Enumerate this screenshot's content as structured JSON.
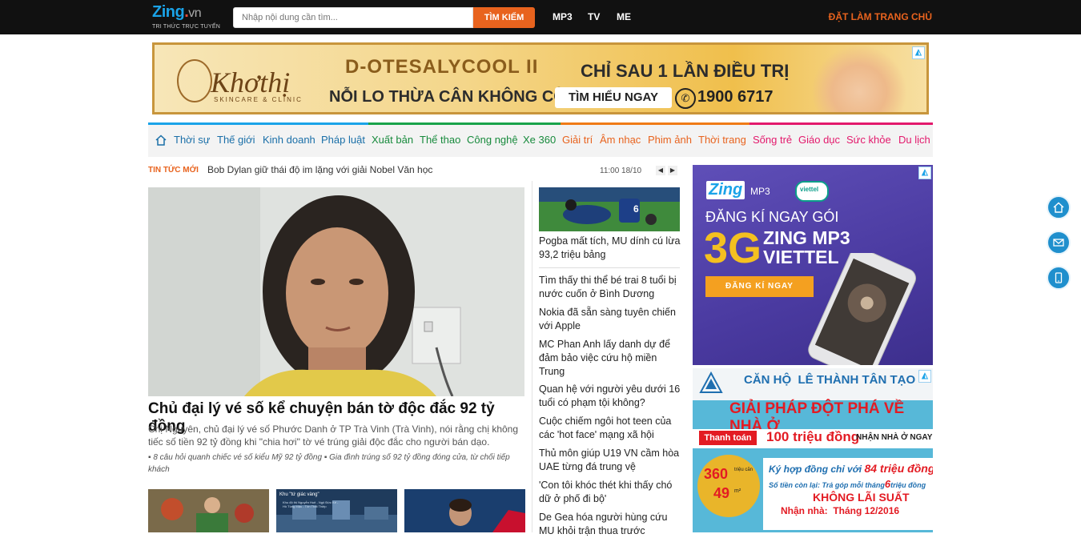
{
  "topbar": {
    "logo_text": "Zing",
    "logo_dot": ".",
    "logo_tld": "vn",
    "logo_tagline": "TRI THỨC TRỰC TUYẾN",
    "search_placeholder": "Nhập nội dung cần tìm...",
    "search_button": "TÌM KIẾM",
    "links": [
      "MP3",
      "TV",
      "ME"
    ],
    "set_homepage": "ĐẶT LÀM TRANG CHỦ",
    "accent": "#e8631e"
  },
  "top_banner": {
    "brand": "Khơthị",
    "brand_sub": "SKINCARE & CLINIC",
    "product": "D-OTESALYCOOL II",
    "slogan": "NỖI LO THỪA CÂN KHÔNG CÒN",
    "headline": "CHỈ SAU 1 LẦN ĐIỀU TRỊ",
    "cta": "TÌM HIỂU NGAY",
    "phone": "1900 6717"
  },
  "categories": {
    "home_icon": "home-icon",
    "group_colors": [
      "#1aa3e8",
      "#19a34a",
      "#f07b16",
      "#e3196c"
    ],
    "items": [
      {
        "label": "Thời sự",
        "color": "#1a6fa8"
      },
      {
        "label": "Thế giới",
        "color": "#1a6fa8"
      },
      {
        "label": "Kinh doanh",
        "color": "#1a6fa8"
      },
      {
        "label": "Pháp luật",
        "color": "#1a6fa8"
      },
      {
        "label": "Xuất bản",
        "color": "#178a3c"
      },
      {
        "label": "Thể thao",
        "color": "#178a3c"
      },
      {
        "label": "Công nghệ",
        "color": "#178a3c"
      },
      {
        "label": "Xe 360",
        "color": "#178a3c"
      },
      {
        "label": "Giải trí",
        "color": "#e8631e"
      },
      {
        "label": "Âm nhạc",
        "color": "#e8631e"
      },
      {
        "label": "Phim ảnh",
        "color": "#e8631e"
      },
      {
        "label": "Thời trang",
        "color": "#e8631e"
      },
      {
        "label": "Sống trẻ",
        "color": "#e3196c"
      },
      {
        "label": "Giáo dục",
        "color": "#e3196c"
      },
      {
        "label": "Sức khỏe",
        "color": "#e3196c"
      },
      {
        "label": "Du lịch",
        "color": "#e3196c"
      }
    ]
  },
  "ticker": {
    "label": "TIN TỨC MỚI",
    "headline": "Bob Dylan giữ thái độ im lặng với giải Nobel Văn học",
    "time": "11:00 18/10"
  },
  "hero": {
    "title": "Chủ đại lý vé số kể chuyện bán tờ độc đắc 92 tỷ đồng",
    "sapo": "Chị Nguyên, chủ đại lý vé số Phước Danh ở TP Trà Vinh (Trà Vinh), nói rằng chị không tiếc số tiền 92 tỷ đồng khi \"chia hơi\" tờ vé trúng giải độc đắc cho người bán dạo.",
    "related": [
      "8 câu hỏi quanh chiếc vé số kiểu Mỹ 92 tỷ đồng",
      "Gia đình trúng số 92 tỷ đồng đóng cửa, từ chối tiếp khách"
    ]
  },
  "thumbs": {
    "middle_caption_1": "Khu \"tứ giác vàng\"",
    "middle_caption_2": "Khu đô thị Nguyễn Huệ - Ngô Đức Kế - Hồ Tùng Mậu - Tôn Thất Thiệp"
  },
  "side_news": {
    "jersey_number": "6",
    "items": [
      "Pogba mất tích, MU dính cú lừa 93,2 triệu bảng",
      "Tìm thấy thi thể bé trai 8 tuổi bị nước cuốn ở Bình Dương",
      "Nokia đã sẵn sàng tuyên chiến với Apple",
      "MC Phan Anh lấy danh dự để đảm bảo việc cứu hộ miền Trung",
      "Quan hệ với người yêu dưới 16 tuổi có phạm tội không?",
      "Cuộc chiếm ngôi hot teen của các 'hot face' mạng xã hội",
      "Thủ môn giúp U19 VN cầm hòa UAE từng đá trung vệ",
      "'Con tôi khóc thét khi thấy chó dữ ở phố đi bộ'",
      "De Gea hóa người hùng cứu MU khỏi trận thua trước"
    ]
  },
  "ad_mp3": {
    "brand": "Zing",
    "brand_sub": "MP3",
    "partner": "viettel",
    "line1": "ĐĂNG KÍ NGAY GÓI",
    "big": "3G",
    "line2a": "ZING MP3",
    "line2b": "VIETTEL",
    "cta": "ĐĂNG KÍ NGAY"
  },
  "ad_realestate": {
    "title": "CĂN HỘ  LÊ THÀNH TÂN TẠO",
    "headline": "GIẢI PHÁP ĐỘT PHÁ VỀ NHÀ Ở",
    "pay_label": "Thanh toán",
    "pay_amount": "100 triệu đồng",
    "pay_suffix": "NHẬN NHÀ Ở NGAY",
    "badge_top": "360",
    "badge_top_unit": "triệu căn",
    "badge_bottom": "49",
    "badge_bottom_unit": "m²",
    "line1_prefix": "Ký hợp đồng chỉ với",
    "line1_amount": "84 triệu đồng",
    "line2_prefix": "Số tiền còn lại: Trả góp mỗi tháng",
    "line2_amount": "6",
    "line2_suffix": "triệu đồng",
    "line3": "KHÔNG LÃI SUẤT",
    "line4": "Nhận nhà:  Tháng 12/2016"
  },
  "float_buttons": [
    "home-icon",
    "mail-icon",
    "mobile-icon"
  ]
}
